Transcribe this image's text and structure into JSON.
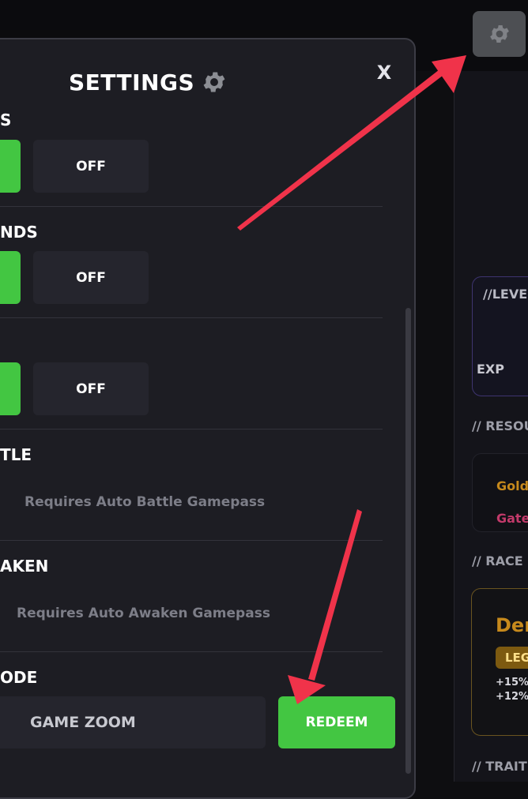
{
  "modal": {
    "title": "SETTINGS",
    "close_label": "X",
    "rows": [
      {
        "label": "S",
        "on_label": "",
        "off_label": "OFF"
      },
      {
        "label": "NDS",
        "on_label": "",
        "off_label": "OFF"
      },
      {
        "label": "",
        "on_label": "",
        "off_label": "OFF"
      },
      {
        "label": "TLE",
        "requirement": "Requires Auto Battle Gamepass"
      },
      {
        "label": "AKEN",
        "requirement": "Requires Auto Awaken Gamepass"
      },
      {
        "label": "ODE",
        "input_value": "GAME ZOOM",
        "button_label": "REDEEM"
      }
    ]
  },
  "side": {
    "level_title": "//LEVE",
    "exp_label": "EXP",
    "resources_label": "// RESOU",
    "gold_label": "Gold",
    "gate_label": "Gate",
    "race_label": "// RACE",
    "race_name": "Der",
    "race_badge": "LEG",
    "race_stats": [
      "+15%",
      "+12%"
    ],
    "traits_label": "// TRAIT"
  },
  "colors": {
    "accent_green": "#43c642",
    "arrow_red": "#f0334a",
    "gold": "#c6891c",
    "gate_pink": "#c23a6a"
  },
  "icons": [
    "gear-icon",
    "settings-gear-icon",
    "close-icon"
  ]
}
